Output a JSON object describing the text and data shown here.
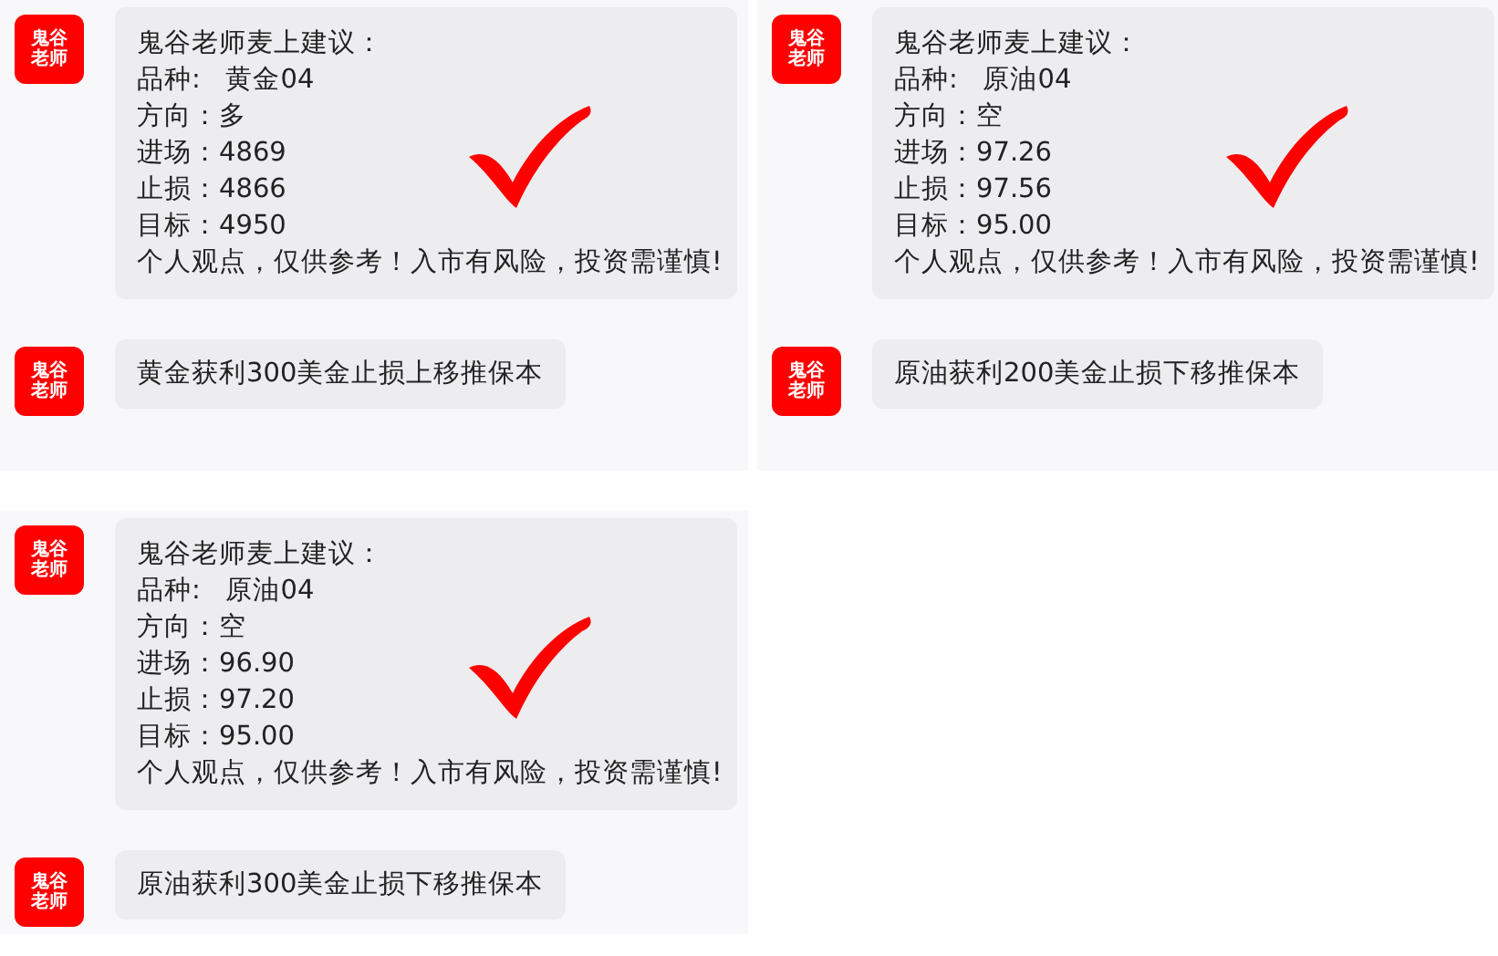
{
  "columns": [
    {
      "panels": [
        {
          "messages": [
            {
              "kind": "advice",
              "avatar": [
                "鬼谷",
                "老师"
              ],
              "checked": true,
              "lines": [
                "鬼谷老师麦上建议：",
                "品种:   黄金04",
                "方向：多",
                "进场：4869",
                "止损：4866",
                "目标：4950",
                "个人观点，仅供参考！入市有风险，投资需谨慎!"
              ]
            },
            {
              "kind": "text",
              "avatar": [
                "鬼谷",
                "老师"
              ],
              "text": "黄金获利300美金止损上移推保本"
            }
          ]
        },
        {
          "messages": [
            {
              "kind": "advice",
              "avatar": [
                "鬼谷",
                "老师"
              ],
              "checked": true,
              "lines": [
                "鬼谷老师麦上建议：",
                "品种:   原油04",
                "方向：空",
                "进场：96.90",
                "止损：97.20",
                "目标：95.00",
                "个人观点，仅供参考！入市有风险，投资需谨慎!"
              ]
            },
            {
              "kind": "text",
              "avatar": [
                "鬼谷",
                "老师"
              ],
              "text": "原油获利300美金止损下移推保本"
            }
          ]
        }
      ]
    },
    {
      "panels": [
        {
          "messages": [
            {
              "kind": "advice",
              "avatar": [
                "鬼谷",
                "老师"
              ],
              "checked": true,
              "lines": [
                "鬼谷老师麦上建议：",
                "品种:   原油04",
                "方向：空",
                "进场：97.26",
                "止损：97.56",
                "目标：95.00",
                "个人观点，仅供参考！入市有风险，投资需谨慎!"
              ]
            },
            {
              "kind": "text",
              "avatar": [
                "鬼谷",
                "老师"
              ],
              "text": "原油获利200美金止损下移推保本"
            }
          ]
        }
      ]
    }
  ]
}
